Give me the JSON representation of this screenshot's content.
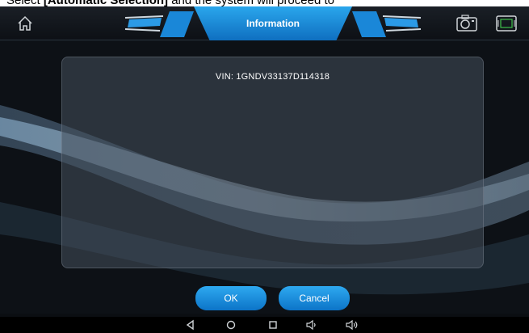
{
  "doc": {
    "caption_prefix": "Select ",
    "caption_bold": "[Automatic Selection]",
    "caption_suffix": " and the system will proceed to"
  },
  "header": {
    "title": "Information",
    "icons": [
      "home-icon",
      "camera-icon",
      "vci-icon"
    ]
  },
  "dialog": {
    "vin_text": "VIN: 1GNDV33137D114318",
    "ok_label": "OK",
    "cancel_label": "Cancel"
  },
  "navbar": {
    "icons": [
      "back-icon",
      "home-circle-icon",
      "recents-icon",
      "volume-down-icon",
      "volume-up-icon"
    ]
  },
  "colors": {
    "accent": "#1a8fdf",
    "button": "#1c8ede",
    "background": "#0b0e12"
  }
}
